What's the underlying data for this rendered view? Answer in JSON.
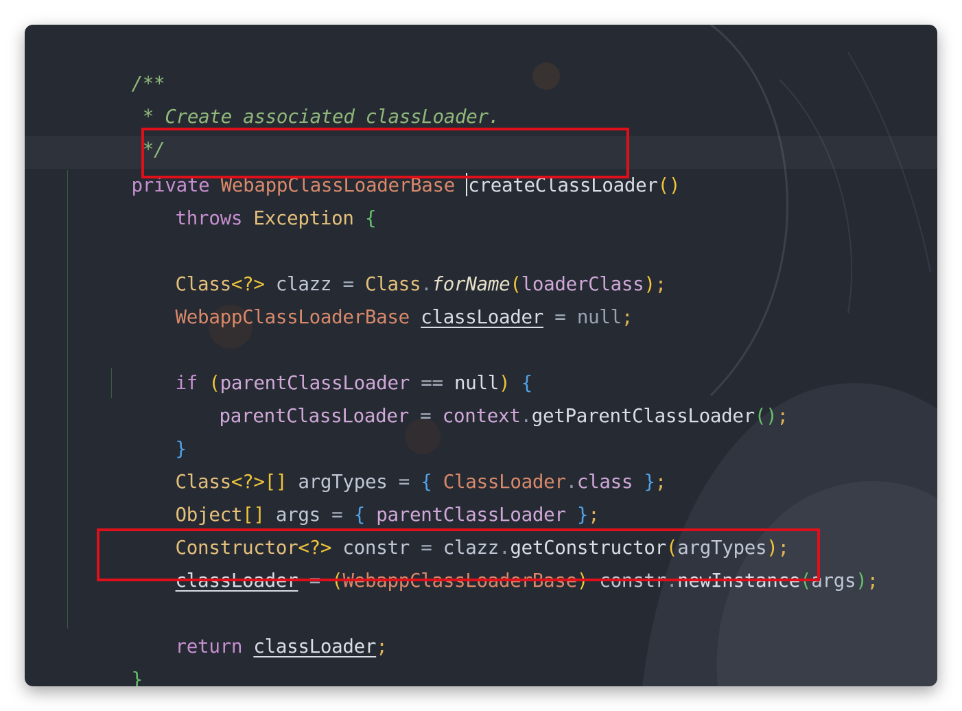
{
  "editor": {
    "comment_open": "/**",
    "comment_body": " * Create associated classLoader.",
    "comment_close": " */",
    "sig": {
      "kw_private": "private",
      "return_type": "WebappClassLoaderBase",
      "method_name": "createClassLoader",
      "parens": "()"
    },
    "throws": {
      "kw": "throws",
      "type": "Exception",
      "brace": "{"
    },
    "line_clazz": {
      "type": "Class",
      "generic": "<?>",
      "var": "clazz",
      "eq": "=",
      "recv": "Class",
      "dot": ".",
      "method": "forName",
      "open": "(",
      "arg": "loaderClass",
      "close": ")",
      "semi": ";"
    },
    "line_loader_decl": {
      "type": "WebappClassLoaderBase",
      "var": "classLoader",
      "eq": "=",
      "value": "null",
      "semi": ";"
    },
    "line_if": {
      "kw": "if",
      "open": "(",
      "field": "parentClassLoader",
      "op": "==",
      "value": "null",
      "close": ")",
      "brace": "{"
    },
    "line_assign_parent": {
      "field": "parentClassLoader",
      "eq": "=",
      "recv": "context",
      "dot": ".",
      "method": "getParentClassLoader",
      "open": "(",
      "close": ")",
      "semi": ";"
    },
    "close_if": "}",
    "line_argtypes": {
      "type": "Class",
      "generic": "<?>",
      "arr": "[]",
      "var": "argTypes",
      "eq": "=",
      "open": "{",
      "cls": "ClassLoader",
      "dot": ".",
      "kw_class": "class",
      "close": "}",
      "semi": ";"
    },
    "line_args": {
      "type": "Object",
      "arr": "[]",
      "var": "args",
      "eq": "=",
      "open": "{",
      "field": "parentClassLoader",
      "close": "}",
      "semi": ";"
    },
    "line_constr": {
      "type": "Constructor",
      "generic": "<?>",
      "var": "constr",
      "eq": "=",
      "recv": "clazz",
      "dot": ".",
      "method": "getConstructor",
      "open": "(",
      "arg": "argTypes",
      "close": ")",
      "semi": ";"
    },
    "line_newinstance": {
      "var": "classLoader",
      "eq": "=",
      "cast_open": "(",
      "cast_type": "WebappClassLoaderBase",
      "cast_close": ")",
      "recv": "constr",
      "dot": ".",
      "method": "newInstance",
      "open": "(",
      "arg": "args",
      "close": ")",
      "semi": ";"
    },
    "line_return": {
      "kw": "return",
      "var": "classLoader",
      "semi": ";"
    },
    "close_method": "}"
  },
  "highlight_color": "#e0101a"
}
